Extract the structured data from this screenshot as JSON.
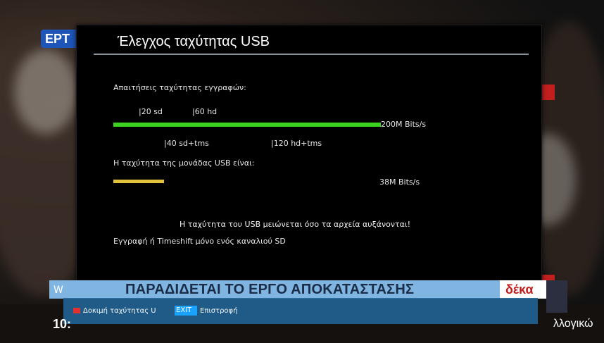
{
  "channel": {
    "logo_text": "ΕΡΤ"
  },
  "modal": {
    "title": "Έλεγχος ταχύτητας USB",
    "requirements_label": "Απαιτήσεις ταχύτητας εγγραφών:",
    "scale": {
      "top_markers": [
        "|20 sd",
        "|60 hd"
      ],
      "bottom_markers": [
        "|40 sd+tms",
        "|120 hd+tms"
      ],
      "max_label": "200M Bits/s",
      "fill_fraction": 1.0
    },
    "usb_speed_label": "Η ταχύτητα της μονάδας USB είναι:",
    "usb_speed_value": "38M Bits/s",
    "usb_fill_fraction": 0.19,
    "warning_line": "Η ταχύτητα του USB μειώνεται όσο τα αρχεία αυξάνονται!",
    "record_line": "Εγγραφή ή Timeshift μόνο ενός καναλιού SD"
  },
  "ticker": {
    "headline": "ΠΑΡΑΔΙΔΕΤΑΙ ΤΟ ΕΡΓΟ ΑΠΟΚΑΤΑΣΤΑΣΗΣ",
    "left_tag": "W",
    "brand": "δέκα"
  },
  "statusbar": {
    "red_label": "Δοκιμή ταχύτητας U",
    "blue_label": "EXIT",
    "blue_action": "Επιστροφή",
    "bottom_left": "10:",
    "bottom_right": "λλογικώ"
  },
  "colors": {
    "green": "#3bd11f",
    "yellow": "#e1c23a",
    "status_blue": "#1f5b86",
    "ticker_blue": "#7fb5e0"
  }
}
